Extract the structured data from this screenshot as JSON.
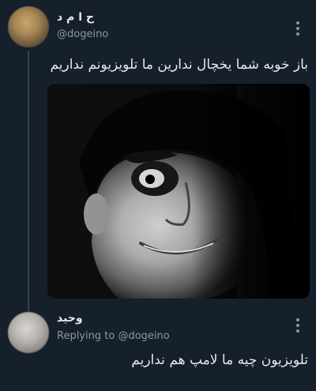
{
  "tweet": {
    "author_name": "ح ا م د",
    "author_handle": "@dogeino",
    "text": "باز خوبه شما یخچال ندارین ما تلویزیونم نداریم",
    "avatar_icon": "blurred-avatar-photo",
    "media_icon": "meme-face-image",
    "menu_icon": "vertical-ellipsis"
  },
  "reply": {
    "author_name": "وحید",
    "replying_prefix": "Replying to",
    "replying_handle": "@dogeino",
    "text": "تلویزیون چیه ما لامپ هم نداریم",
    "avatar_icon": "blurred-avatar-photo",
    "menu_icon": "vertical-ellipsis"
  },
  "colors": {
    "background": "#15202b",
    "primary_text": "#e7e9ea",
    "secondary_text": "#8b98a5",
    "thread_line": "#38444d"
  }
}
